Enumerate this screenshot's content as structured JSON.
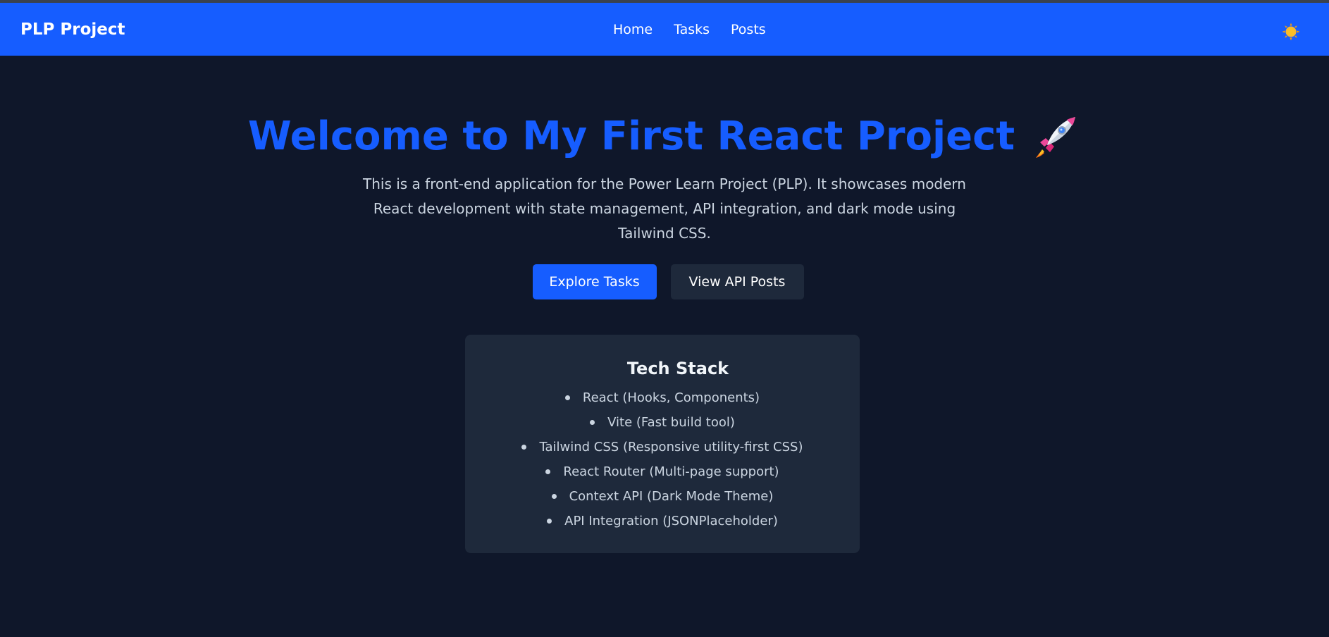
{
  "navbar": {
    "brand": "PLP Project",
    "links": [
      "Home",
      "Tasks",
      "Posts"
    ],
    "theme_toggle_icon": "sun-icon"
  },
  "hero": {
    "title": "Welcome to My First React Project",
    "title_icon": "rocket-icon",
    "description": "This is a front-end application for the Power Learn Project (PLP). It showcases modern React development with state management, API integration, and dark mode using Tailwind CSS.",
    "primary_button": "Explore Tasks",
    "secondary_button": "View API Posts"
  },
  "tech_stack": {
    "title": "Tech Stack",
    "items": [
      "React (Hooks, Components)",
      "Vite (Fast build tool)",
      "Tailwind CSS (Responsive utility-first CSS)",
      "React Router (Multi-page support)",
      "Context API (Dark Mode Theme)",
      "API Integration (JSONPlaceholder)"
    ]
  },
  "colors": {
    "accent": "#165dff",
    "background": "#0f172a",
    "card": "#1e293b",
    "text_muted": "#cbd5e1"
  }
}
